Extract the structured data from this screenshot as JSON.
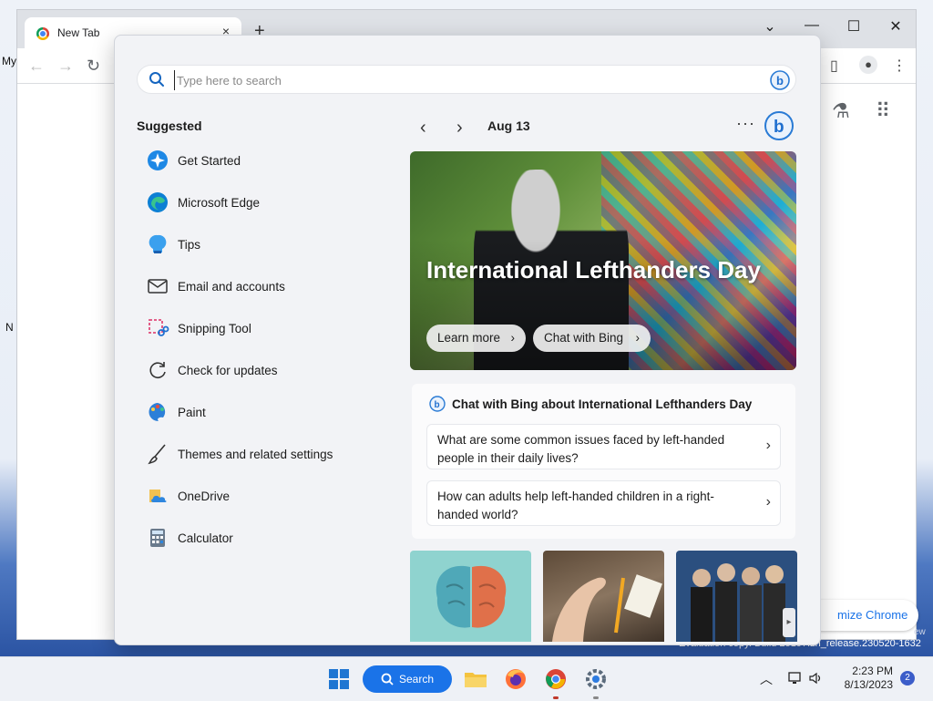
{
  "desktop": {
    "frag_top": "My",
    "frag_mid": "N"
  },
  "browser": {
    "tab_title": "New Tab",
    "tab_close": "×",
    "new_tab": "+",
    "customize_label": "mize Chrome",
    "window_controls": [
      "⌄",
      "—",
      "☐",
      "✕"
    ]
  },
  "watermark": {
    "text": "Evaluation copy. Build 25197.zn_release.230520-1632",
    "edge": "ew"
  },
  "start_menu": {
    "search_placeholder": "Type here to search",
    "suggested_heading": "Suggested",
    "suggested": [
      {
        "label": "Get Started",
        "icon": "get-started-icon"
      },
      {
        "label": "Microsoft Edge",
        "icon": "edge-icon"
      },
      {
        "label": "Tips",
        "icon": "tips-icon"
      },
      {
        "label": "Email and accounts",
        "icon": "mail-icon"
      },
      {
        "label": "Snipping Tool",
        "icon": "snipping-tool-icon"
      },
      {
        "label": "Check for updates",
        "icon": "refresh-icon"
      },
      {
        "label": "Paint",
        "icon": "paint-icon"
      },
      {
        "label": "Themes and related settings",
        "icon": "brush-icon"
      },
      {
        "label": "OneDrive",
        "icon": "onedrive-icon"
      },
      {
        "label": "Calculator",
        "icon": "calculator-icon"
      }
    ],
    "feed": {
      "date": "Aug 13",
      "more": "···",
      "hero_title": "International Lefthanders Day",
      "learn_more": "Learn more",
      "chat_with_bing": "Chat with Bing",
      "chat_heading": "Chat with Bing about International Lefthanders Day",
      "questions": [
        "What are some common issues faced by left-handed people in their daily lives?",
        "How can adults help left-handed children in a right-handed world?"
      ]
    }
  },
  "taskbar": {
    "search_label": "Search",
    "time": "2:23 PM",
    "date": "8/13/2023",
    "notification_count": "2"
  },
  "colors": {
    "accent": "#1a73e8",
    "taskbar_bg": "#eef1f6",
    "menu_bg": "#f2f3f6"
  }
}
